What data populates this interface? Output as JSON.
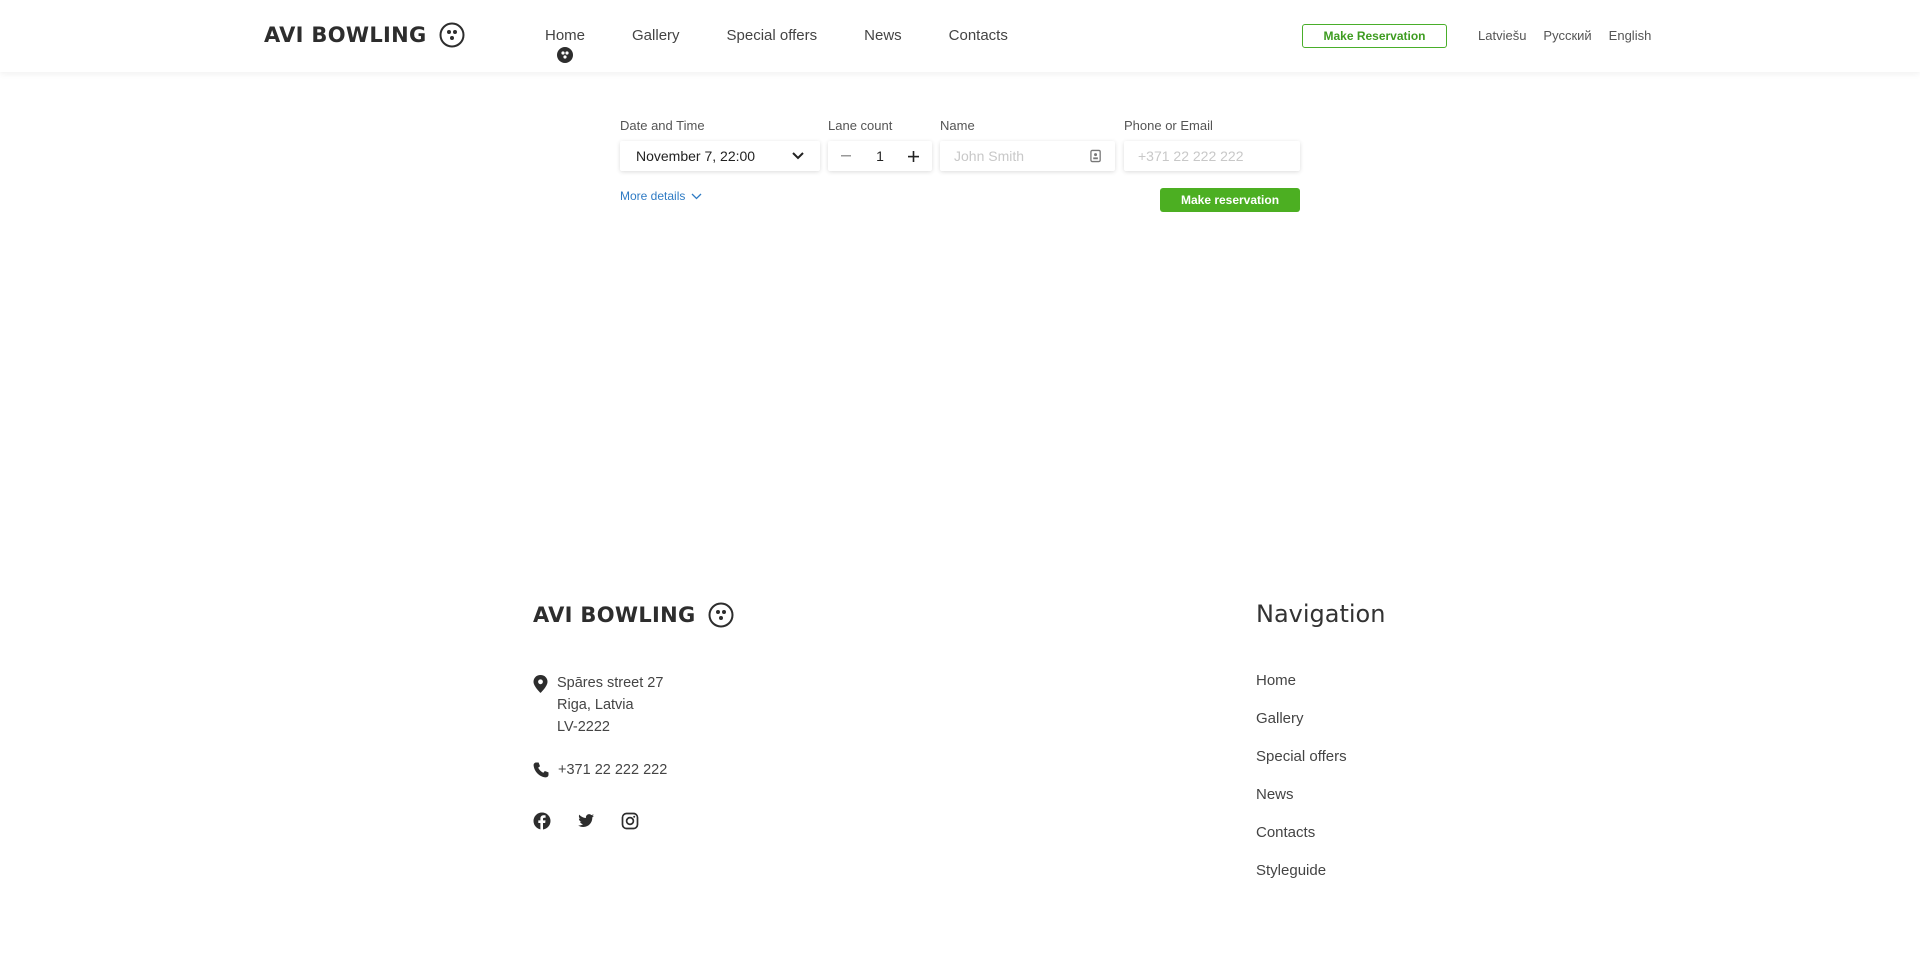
{
  "header": {
    "logo_text": "AVI BOWLING",
    "nav": [
      {
        "label": "Home",
        "active": true
      },
      {
        "label": "Gallery"
      },
      {
        "label": "Special offers"
      },
      {
        "label": "News"
      },
      {
        "label": "Contacts"
      }
    ],
    "reserve_button": "Make Reservation",
    "languages": [
      "Latviešu",
      "Русский",
      "English"
    ]
  },
  "booking": {
    "date_label": "Date and Time",
    "date_value": "November 7, 22:00",
    "lanes_label": "Lane count",
    "lanes_value": "1",
    "name_label": "Name",
    "name_placeholder": "John Smith",
    "contact_label": "Phone or Email",
    "contact_placeholder": "+371 22 222 222",
    "more_details": "More details",
    "submit": "Make reservation"
  },
  "footer": {
    "logo_text": "AVI BOWLING",
    "address": [
      "Spāres street 27",
      "Riga, Latvia",
      "LV-2222"
    ],
    "phone": "+371 22 222 222",
    "socials": [
      "facebook-icon",
      "twitter-icon",
      "instagram-icon"
    ],
    "nav_title": "Navigation",
    "nav": [
      "Home",
      "Gallery",
      "Special offers",
      "News",
      "Contacts",
      "Styleguide"
    ]
  },
  "colors": {
    "accent_green": "#4caf22",
    "link_blue": "#2f7bc4",
    "text_dark": "#333333"
  }
}
